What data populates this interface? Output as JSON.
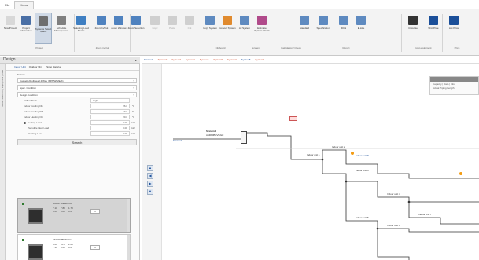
{
  "menu": {
    "tabs": [
      "File",
      "Home"
    ]
  },
  "ribbon": {
    "buttons": [
      {
        "label": "New Project",
        "color": "#d8d8d8"
      },
      {
        "label": "Project Information",
        "color": "#4a6fa5"
      },
      {
        "label": "Systems Select Space",
        "color": "#6e6e6e"
      },
      {
        "label": "Schedule Management",
        "color": "#7f7f7f"
      },
      {
        "label": "Selecting Load Factor",
        "color": "#3f7fc2"
      },
      {
        "label": "Zoom In/Out",
        "color": "#4f82bf"
      },
      {
        "label": "Zoom Window",
        "color": "#4f82bf"
      },
      {
        "label": "Zoom Selection",
        "color": "#4f82bf"
      },
      {
        "label": "Copy",
        "color": "#cfcfcf"
      },
      {
        "label": "Paste",
        "color": "#cfcfcf"
      },
      {
        "label": "Cut",
        "color": "#cfcfcf"
      },
      {
        "label": "Copy System",
        "color": "#5e8ac0"
      },
      {
        "label": "Convert System",
        "color": "#e08a2e"
      },
      {
        "label": "All System",
        "color": "#5e8ac0"
      },
      {
        "label": "Estimate System Check",
        "color": "#b04a8a"
      },
      {
        "label": "Standard",
        "color": "#5e8ac0"
      },
      {
        "label": "Specification",
        "color": "#5e8ac0"
      },
      {
        "label": "DCS",
        "color": "#5e8ac0"
      },
      {
        "label": "E-Like",
        "color": "#5e8ac0"
      },
      {
        "label": "Circulate",
        "color": "#333333"
      },
      {
        "label": "Unit Price",
        "color": "#1b4f99"
      },
      {
        "label": "List Price",
        "color": "#1b4f99"
      }
    ],
    "groups": [
      "Project",
      "Zoom in/Out",
      "Clipboard",
      "System",
      "Calculation / Check",
      "Report",
      "Cost equipment",
      "Price"
    ]
  },
  "design": {
    "title": "Design",
    "pin": "▸",
    "side_label": "Model Selection | Equipment | Data"
  },
  "panel": {
    "tabs": [
      "Indoor Unit",
      "Outdoor Unit",
      "Piping Material"
    ],
    "search_label": "Search",
    "combo1": "Cassette/Multihead 4-Way (MPRW62E/S)",
    "combo2": "Spec. Condition",
    "combo3": "Design Condition",
    "rows": [
      {
        "label": "Airflow Mode",
        "value": "High",
        "unit": ""
      },
      {
        "label": "Indoor Cooling DB",
        "value": "26.0",
        "unit": "°C"
      },
      {
        "label": "Indoor Cooling WB",
        "value": "19.0",
        "unit": "°C"
      },
      {
        "label": "Indoor Heating DB",
        "value": "20.0",
        "unit": "°C"
      },
      {
        "label": "Cooling Load",
        "value": "0.00",
        "unit": "kW"
      },
      {
        "label": "Sensible Heat Load",
        "value": "0.00",
        "unit": "kW"
      },
      {
        "label": "Heating Load",
        "value": "0.00",
        "unit": "kW"
      }
    ],
    "search_button": "Search",
    "cards": [
      {
        "model": "AMX071BN4DKG",
        "v1": [
          "7.10",
          "7.80",
          "1.70"
        ],
        "v2": [
          "5.60",
          "6.80",
          "0.0"
        ],
        "qty": "1"
      },
      {
        "model": "AMX090BN4DKG",
        "v1": [
          "9.00",
          "10.0",
          "2.00"
        ],
        "v2": [
          "7.10",
          "8.00",
          "0.0"
        ],
        "qty": "1"
      }
    ]
  },
  "systabs": [
    {
      "label": "System1",
      "blue": true
    },
    {
      "label": "System2"
    },
    {
      "label": "System3"
    },
    {
      "label": "System4"
    },
    {
      "label": "System5"
    },
    {
      "label": "System6"
    },
    {
      "label": "System7"
    },
    {
      "label": "System8",
      "blue": true
    },
    {
      "label": "System9"
    }
  ],
  "canvas": {
    "info_title": "Capacity | Data | Info",
    "info_text": "Actual Piping Length",
    "system_label": "System1",
    "system_sub": "AM080BXVGGH",
    "nodes": [
      "Indoor unit 1",
      "Indoor unit 2",
      "Indoor unit 3",
      "Indoor unit 4",
      "Indoor unit 5",
      "Indoor unit 6",
      "Indoor unit 7",
      "Indoor unit 8"
    ]
  },
  "nav": [
    "▲",
    "◀",
    "▶",
    "▼"
  ]
}
